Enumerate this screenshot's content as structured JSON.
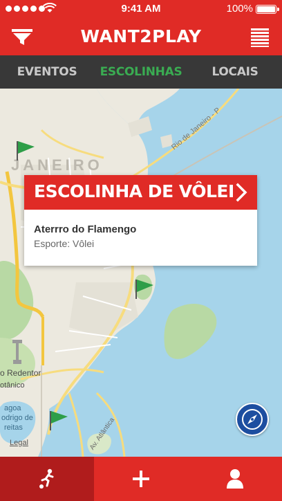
{
  "status_bar": {
    "time": "9:41 AM",
    "battery": "100%",
    "battery_level": 1.0
  },
  "header": {
    "title": "WANT2PLAY"
  },
  "tabs": [
    {
      "label": "EVENTOS",
      "active": false
    },
    {
      "label": "ESCOLINHAS",
      "active": true
    },
    {
      "label": "LOCAIS",
      "active": false
    }
  ],
  "map": {
    "labels": {
      "city": "JANEIRO",
      "road": "Rio de Janeiro - P",
      "redentor": "o Redentor",
      "botanico": "otânico",
      "lagoa1": "agoa",
      "lagoa2": "odrigo de",
      "lagoa3": "reitas",
      "atlantica": "Av. Atlântica",
      "legal": "Legal"
    }
  },
  "card": {
    "title": "ESCOLINHA DE VÔLEI",
    "place": "Aterrro do Flamengo",
    "sport": "Esporte: Vôlei"
  },
  "colors": {
    "brand_red": "#e02b26",
    "dark_red": "#b01c1c",
    "tab_bg": "#383838",
    "active_tab": "#3aac52",
    "flag_green": "#2e9e48",
    "compass_blue": "#1d4ea0"
  },
  "icons": {
    "filter": "filter-icon",
    "menu": "menu-icon",
    "soccer": "soccer-player-icon",
    "add": "plus-icon",
    "profile": "user-icon",
    "compass": "compass-icon",
    "chevron": "chevron-right-icon",
    "flag": "flag-icon"
  }
}
